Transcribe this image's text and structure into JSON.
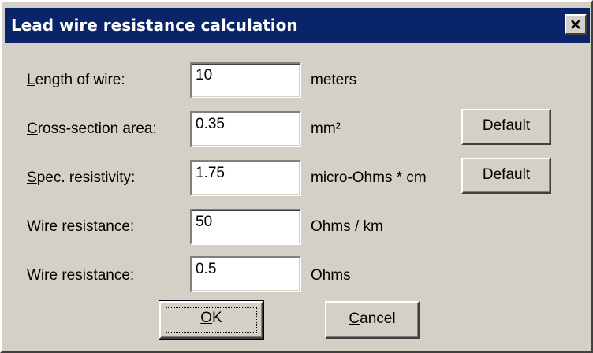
{
  "window": {
    "title": "Lead wire resistance calculation",
    "close_symbol": "close-icon"
  },
  "rows": [
    {
      "label_accel": "L",
      "label_rest": "ength of wire:",
      "value": "10",
      "unit": "meters"
    },
    {
      "label_accel": "C",
      "label_rest": "ross-section area:",
      "value": "0.35",
      "unit": "mm²"
    },
    {
      "label_accel": "S",
      "label_rest": "pec. resistivity:",
      "value": "1.75",
      "unit": "micro-Ohms * cm"
    },
    {
      "label_accel": "W",
      "label_rest": "ire resistance:",
      "value": "50",
      "unit": "Ohms / km"
    },
    {
      "label_pre": "Wire ",
      "label_accel": "r",
      "label_rest": "esistance:",
      "value": "0.5",
      "unit": "Ohms"
    }
  ],
  "buttons": {
    "default_1": "Default",
    "default_2": "Default",
    "ok_accel": "O",
    "ok_rest": "K",
    "cancel_accel": "C",
    "cancel_rest": "ancel"
  }
}
